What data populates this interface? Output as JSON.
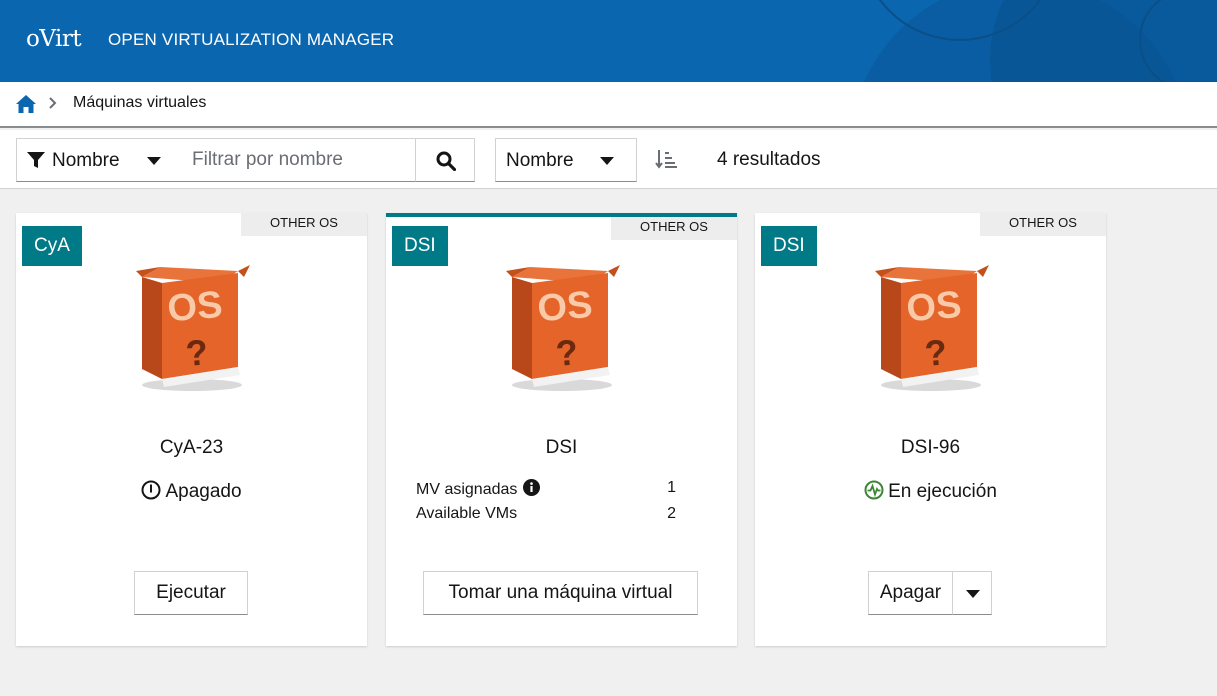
{
  "header": {
    "logo": "oVirt",
    "title": "OPEN VIRTUALIZATION MANAGER"
  },
  "breadcrumb": {
    "home_icon": "home-icon",
    "current": "Máquinas virtuales"
  },
  "toolbar": {
    "filter_field": "Nombre",
    "filter_placeholder": "Filtrar por nombre",
    "sort_field": "Nombre",
    "results": "4 resultados"
  },
  "colors": {
    "header": "#0b66b0",
    "accent": "#007a87",
    "running": "#3e8635"
  },
  "cards": [
    {
      "tag": "CyA",
      "os": "OTHER OS",
      "name": "CyA-23",
      "status": "Apagado",
      "status_icon": "power-off-icon",
      "action": "Ejecutar"
    },
    {
      "tag": "DSI",
      "os": "OTHER OS",
      "name": "DSI",
      "assigned_label": "MV asignadas",
      "assigned_value": "1",
      "available_label": "Available VMs",
      "available_value": "2",
      "action": "Tomar una máquina virtual"
    },
    {
      "tag": "DSI",
      "os": "OTHER OS",
      "name": "DSI-96",
      "status": "En ejecución",
      "status_icon": "running-icon",
      "action": "Apagar"
    }
  ]
}
